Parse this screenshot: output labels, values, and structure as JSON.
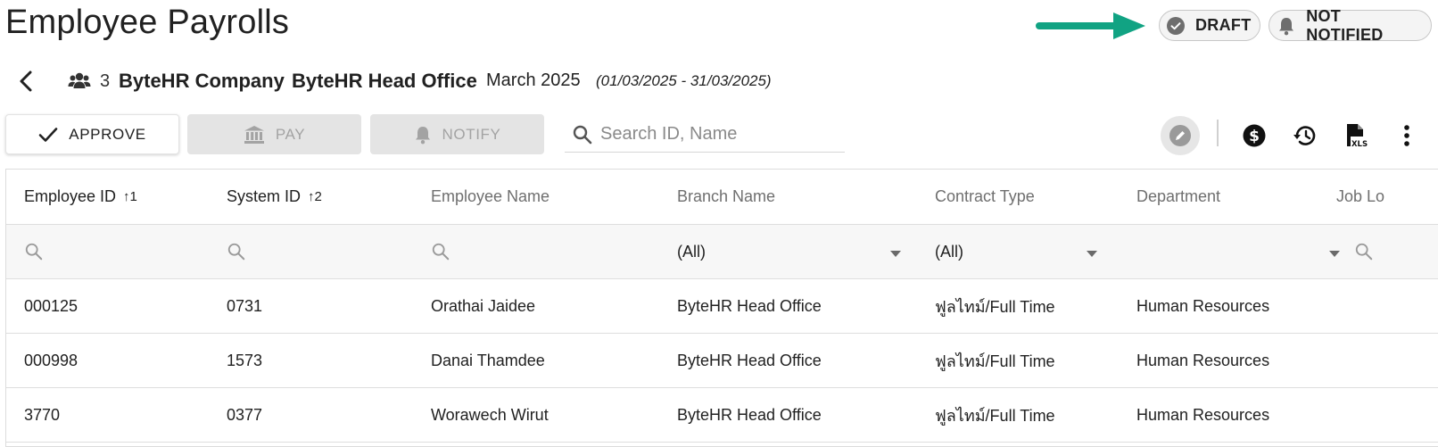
{
  "page": {
    "title": "Employee Payrolls"
  },
  "status": {
    "draft_label": "DRAFT",
    "notified_label": "NOT NOTIFIED"
  },
  "header": {
    "employee_count": "3",
    "company": "ByteHR Company",
    "branch": "ByteHR Head Office",
    "period": "March 2025",
    "date_range": "(01/03/2025 - 31/03/2025)"
  },
  "toolbar": {
    "approve_label": "APPROVE",
    "pay_label": "PAY",
    "notify_label": "NOTIFY",
    "search_placeholder": "Search ID, Name",
    "icons": [
      "edit-icon",
      "money-icon",
      "history-icon",
      "xls-export-icon",
      "more-vert-icon"
    ]
  },
  "colors": {
    "accent_arrow": "#11a383",
    "disabled_bg": "#e4e4e4",
    "disabled_text": "#a3a3a3"
  },
  "table": {
    "columns": [
      {
        "label": "Employee ID",
        "sort": "↑1"
      },
      {
        "label": "System ID",
        "sort": "↑2"
      },
      {
        "label": "Employee Name",
        "sort": ""
      },
      {
        "label": "Branch Name",
        "sort": ""
      },
      {
        "label": "Contract Type",
        "sort": ""
      },
      {
        "label": "Department",
        "sort": ""
      },
      {
        "label": "Job Lo",
        "sort": ""
      }
    ],
    "filters": {
      "branch": "(All)",
      "contract": "(All)"
    },
    "rows": [
      {
        "employee_id": "000125",
        "system_id": "0731",
        "name": "Orathai Jaidee",
        "branch": "ByteHR Head Office",
        "contract": "ฟูลไทม์/Full Time",
        "department": "Human Resources"
      },
      {
        "employee_id": "000998",
        "system_id": "1573",
        "name": "Danai Thamdee",
        "branch": "ByteHR Head Office",
        "contract": "ฟูลไทม์/Full Time",
        "department": "Human Resources"
      },
      {
        "employee_id": "3770",
        "system_id": "0377",
        "name": "Worawech Wirut",
        "branch": "ByteHR Head Office",
        "contract": "ฟูลไทม์/Full Time",
        "department": "Human Resources"
      }
    ]
  }
}
